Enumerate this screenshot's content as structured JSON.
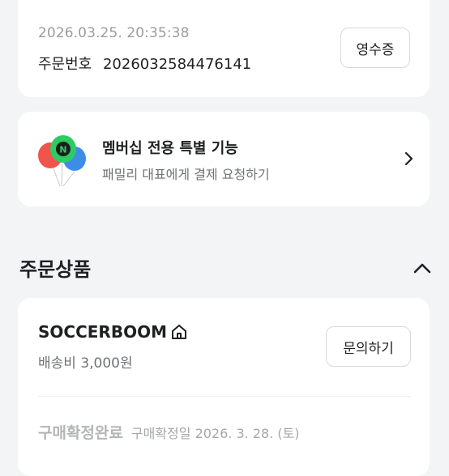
{
  "order": {
    "datetime": "2026.03.25. 20:35:38",
    "number_label": "주문번호",
    "number": "2026032584476141",
    "receipt_button": "영수증"
  },
  "membership": {
    "title": "멤버십 전용 특별 기능",
    "subtitle": "패밀리 대표에게 결제 요청하기",
    "badge_letter": "N"
  },
  "section": {
    "title": "주문상품"
  },
  "product": {
    "store_name": "SOCCERBOOM",
    "shipping": "배송비 3,000원",
    "inquiry_button": "문의하기",
    "status": "구매확정완료",
    "confirm_date": "구매확정일 2026. 3. 28. (토)"
  },
  "colors": {
    "background": "#f3f4f6",
    "card": "#ffffff",
    "balloon_red": "#f0544a",
    "balloon_green": "#2ecb63",
    "balloon_blue": "#3d8de8",
    "badge_dark": "#1b1f1c"
  },
  "icons": {
    "balloons": "balloons-illustration",
    "chevron": "chevron-right-icon",
    "collapse": "chevron-up-icon",
    "home": "home-icon"
  }
}
